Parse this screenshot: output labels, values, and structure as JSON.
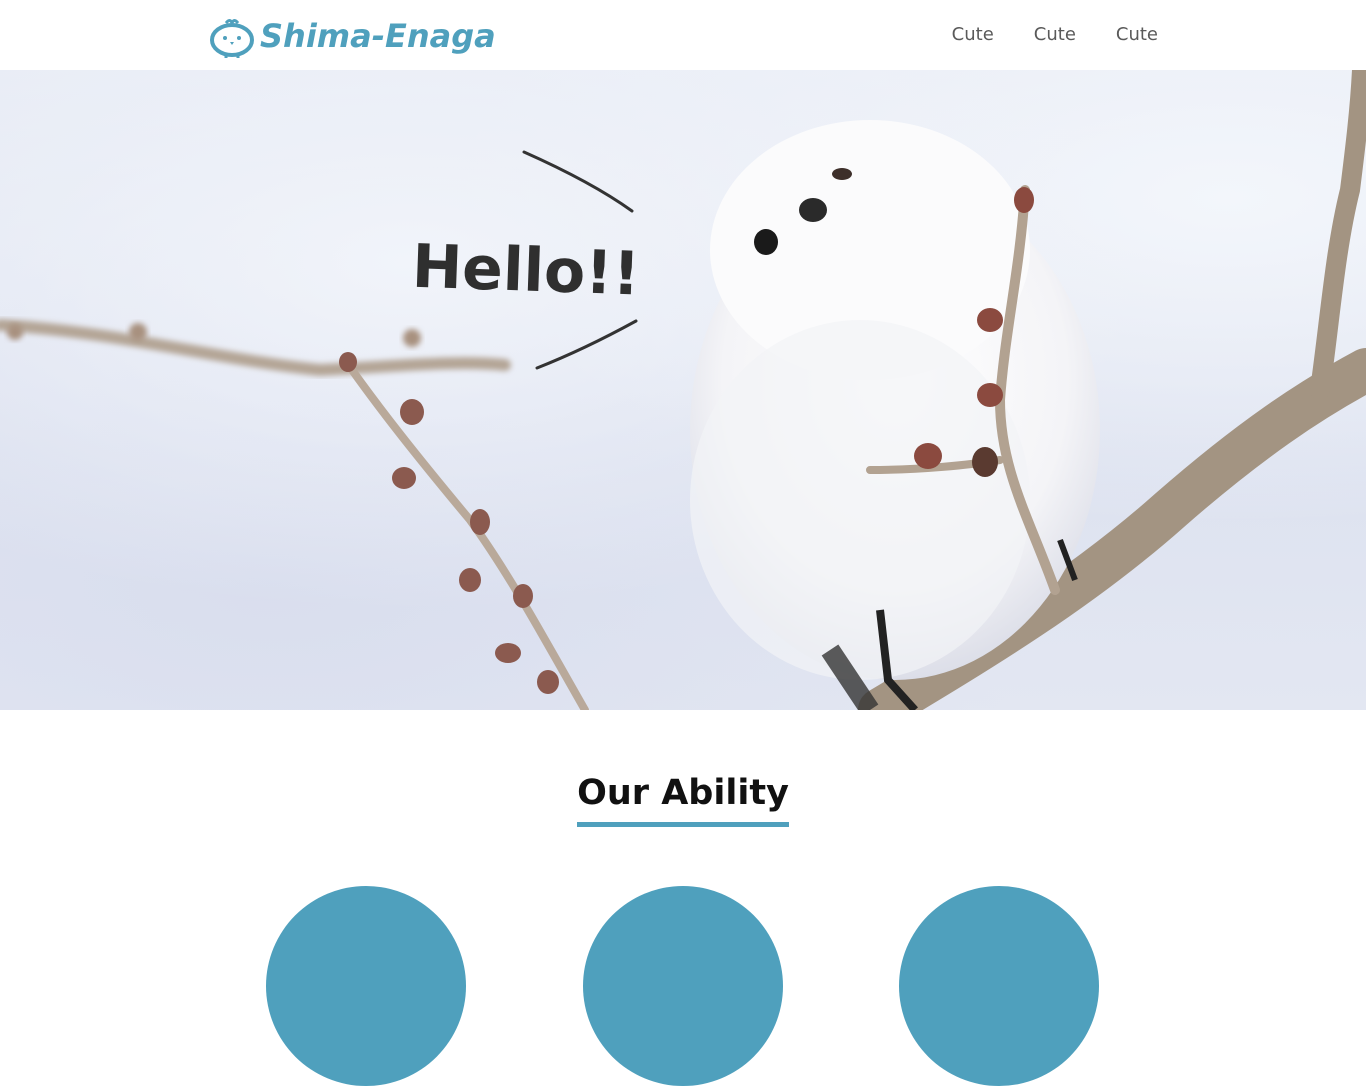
{
  "header": {
    "logo_text": "Shima-Enaga",
    "nav": [
      {
        "label": "Cute"
      },
      {
        "label": "Cute"
      },
      {
        "label": "Cute"
      }
    ]
  },
  "hero": {
    "greeting": "Hello!!"
  },
  "main": {
    "section_title": "Our Ability"
  },
  "colors": {
    "accent": "#4fa0bd",
    "nav_text": "#5a5a5a",
    "title_text": "#111111"
  }
}
